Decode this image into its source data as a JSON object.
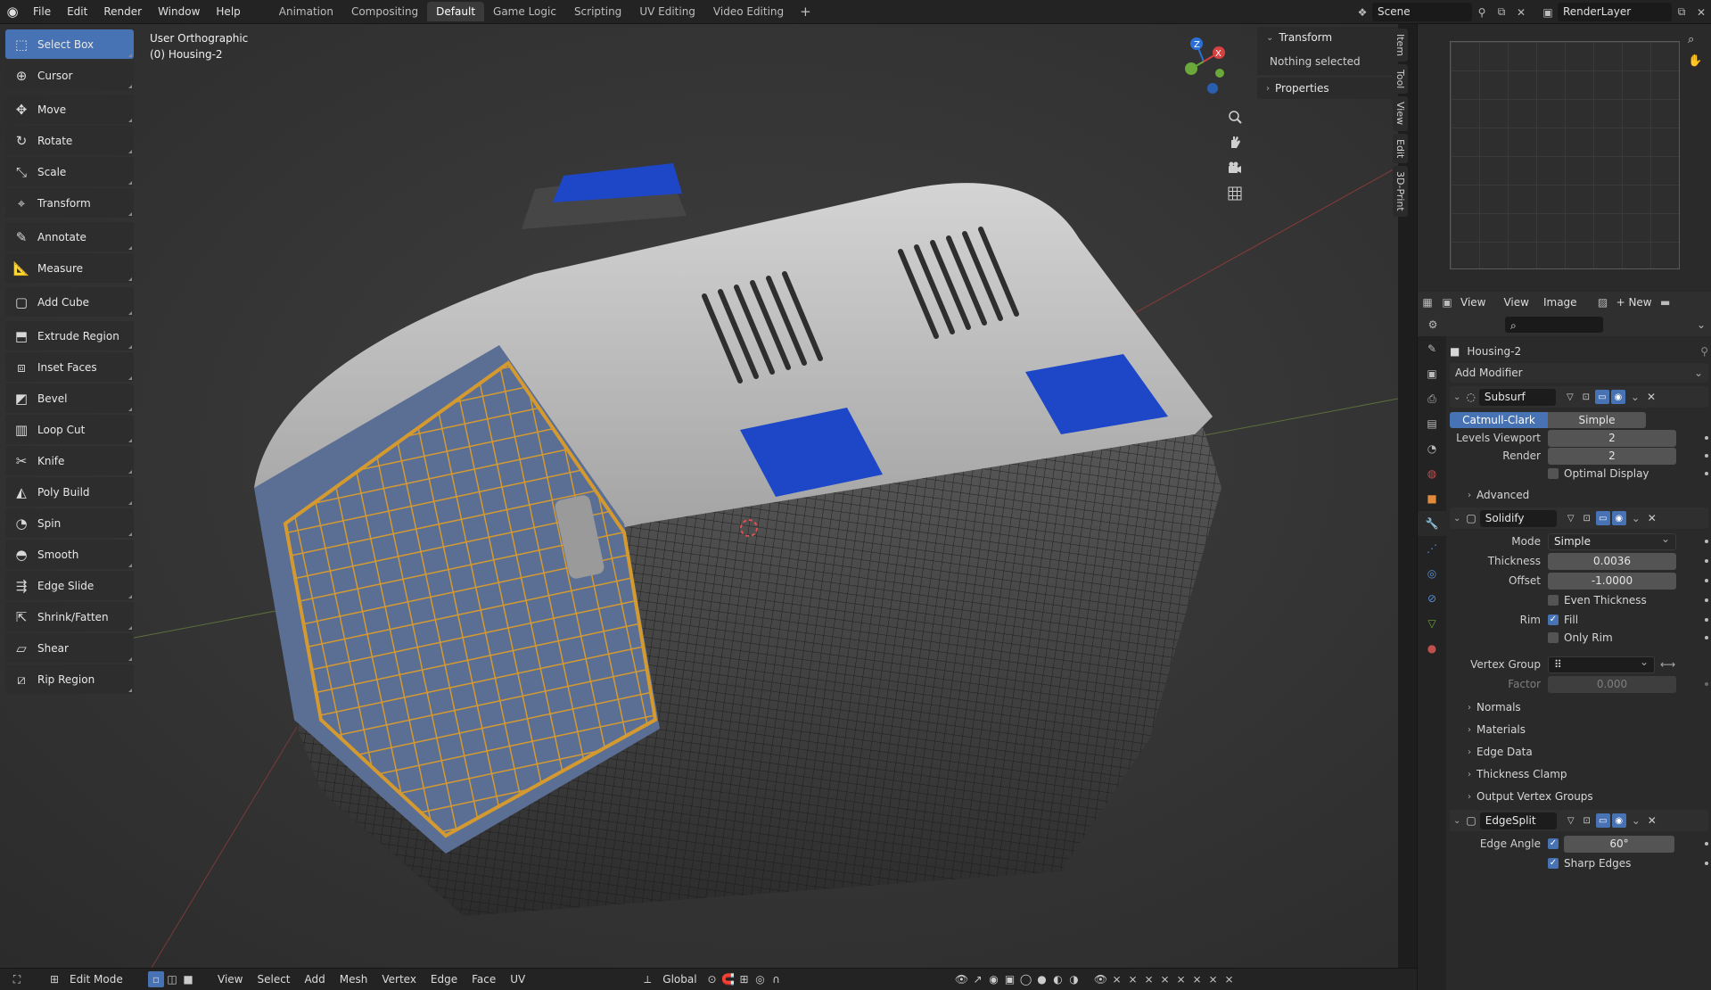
{
  "topbar": {
    "menus": [
      "File",
      "Edit",
      "Render",
      "Window",
      "Help"
    ],
    "workspaces": [
      "Animation",
      "Compositing",
      "Default",
      "Game Logic",
      "Scripting",
      "UV Editing",
      "Video Editing"
    ],
    "active_workspace": "Default",
    "scene": "Scene",
    "render_layer": "RenderLayer"
  },
  "viewport": {
    "view_name": "User Orthographic",
    "object_info": "(0) Housing-2",
    "gizmo": {
      "z": "Z",
      "x": "X",
      "y": "Y"
    }
  },
  "toolbar": {
    "tools": [
      {
        "label": "Select Box",
        "icon": "select-box-icon",
        "active": true,
        "gap": false
      },
      {
        "label": "Cursor",
        "icon": "cursor-icon",
        "active": false,
        "gap": false
      },
      {
        "label": "Move",
        "icon": "move-icon",
        "active": false,
        "gap": true
      },
      {
        "label": "Rotate",
        "icon": "rotate-icon",
        "active": false,
        "gap": false
      },
      {
        "label": "Scale",
        "icon": "scale-icon",
        "active": false,
        "gap": false
      },
      {
        "label": "Transform",
        "icon": "transform-icon",
        "active": false,
        "gap": false
      },
      {
        "label": "Annotate",
        "icon": "annotate-icon",
        "active": false,
        "gap": true
      },
      {
        "label": "Measure",
        "icon": "measure-icon",
        "active": false,
        "gap": false
      },
      {
        "label": "Add Cube",
        "icon": "add-cube-icon",
        "active": false,
        "gap": true
      },
      {
        "label": "Extrude Region",
        "icon": "extrude-region-icon",
        "active": false,
        "gap": true
      },
      {
        "label": "Inset Faces",
        "icon": "inset-faces-icon",
        "active": false,
        "gap": false
      },
      {
        "label": "Bevel",
        "icon": "bevel-icon",
        "active": false,
        "gap": false
      },
      {
        "label": "Loop Cut",
        "icon": "loop-cut-icon",
        "active": false,
        "gap": false
      },
      {
        "label": "Knife",
        "icon": "knife-icon",
        "active": false,
        "gap": false
      },
      {
        "label": "Poly Build",
        "icon": "poly-build-icon",
        "active": false,
        "gap": false
      },
      {
        "label": "Spin",
        "icon": "spin-icon",
        "active": false,
        "gap": false
      },
      {
        "label": "Smooth",
        "icon": "smooth-icon",
        "active": false,
        "gap": false
      },
      {
        "label": "Edge Slide",
        "icon": "edge-slide-icon",
        "active": false,
        "gap": false
      },
      {
        "label": "Shrink/Fatten",
        "icon": "shrink-fatten-icon",
        "active": false,
        "gap": false
      },
      {
        "label": "Shear",
        "icon": "shear-icon",
        "active": false,
        "gap": false
      },
      {
        "label": "Rip Region",
        "icon": "rip-region-icon",
        "active": false,
        "gap": false
      }
    ]
  },
  "npanel": {
    "transform_title": "Transform",
    "transform_body": "Nothing selected",
    "properties_title": "Properties",
    "tabs": [
      "Item",
      "Tool",
      "View",
      "Edit",
      "3D-Print"
    ]
  },
  "image_editor": {
    "view": "View",
    "view2": "View",
    "image": "Image",
    "new": "New"
  },
  "properties": {
    "object_name": "Housing-2",
    "add_modifier": "Add Modifier",
    "subsurf": {
      "name": "Subsurf",
      "type_a": "Catmull-Clark",
      "type_b": "Simple",
      "levels_viewport_label": "Levels Viewport",
      "levels_viewport": "2",
      "render_label": "Render",
      "render": "2",
      "optimal_display": "Optimal Display",
      "advanced": "Advanced"
    },
    "solidify": {
      "name": "Solidify",
      "mode_label": "Mode",
      "mode": "Simple",
      "thickness_label": "Thickness",
      "thickness": "0.0036",
      "offset_label": "Offset",
      "offset": "-1.0000",
      "even_thickness": "Even Thickness",
      "rim_label": "Rim",
      "fill": "Fill",
      "only_rim": "Only Rim",
      "vertex_group_label": "Vertex Group",
      "factor_label": "Factor",
      "factor": "0.000",
      "sections": [
        "Normals",
        "Materials",
        "Edge Data",
        "Thickness Clamp",
        "Output Vertex Groups"
      ]
    },
    "edgesplit": {
      "name": "EdgeSplit",
      "edge_angle_label": "Edge Angle",
      "edge_angle": "60°",
      "sharp_edges": "Sharp Edges"
    }
  },
  "bottombar": {
    "mode": "Edit Mode",
    "menus": [
      "View",
      "Select",
      "Add",
      "Mesh",
      "Vertex",
      "Edge",
      "Face",
      "UV"
    ],
    "orientation": "Global"
  },
  "colors": {
    "accent": "#4772b3",
    "background": "#1d1d1d",
    "panel": "#2a2a2a"
  }
}
